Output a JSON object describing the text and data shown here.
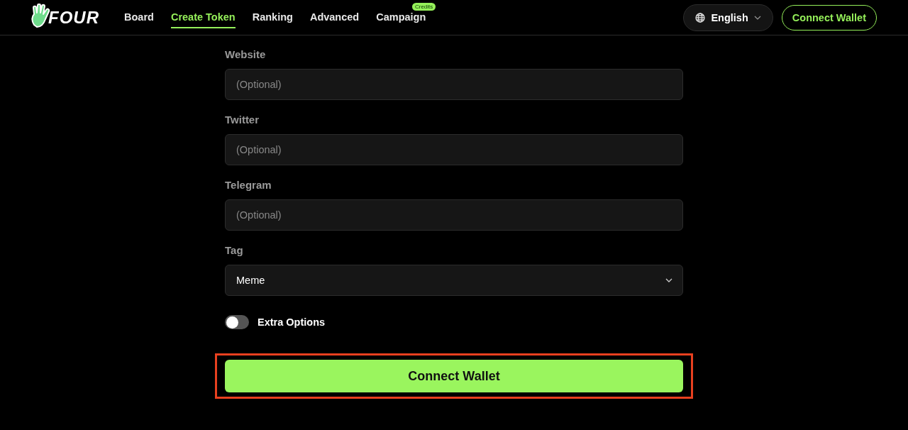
{
  "header": {
    "logo": "FOUR",
    "nav": [
      {
        "label": "Board",
        "selected": false
      },
      {
        "label": "Create Token",
        "selected": true
      },
      {
        "label": "Ranking",
        "selected": false
      },
      {
        "label": "Advanced",
        "selected": false
      },
      {
        "label": "Campaign",
        "selected": false,
        "badge": "Credits"
      }
    ],
    "language": "English",
    "connect_button": "Connect Wallet"
  },
  "form": {
    "fields": [
      {
        "kind": "input",
        "label": "Website",
        "placeholder": "(Optional)"
      },
      {
        "kind": "input",
        "label": "Twitter",
        "placeholder": "(Optional)"
      },
      {
        "kind": "input",
        "label": "Telegram",
        "placeholder": "(Optional)"
      },
      {
        "kind": "select",
        "label": "Tag",
        "value": "Meme"
      }
    ],
    "toggle": {
      "label": "Extra Options",
      "on": false
    },
    "submit": {
      "label": "Connect Wallet",
      "highlighted": true
    }
  }
}
